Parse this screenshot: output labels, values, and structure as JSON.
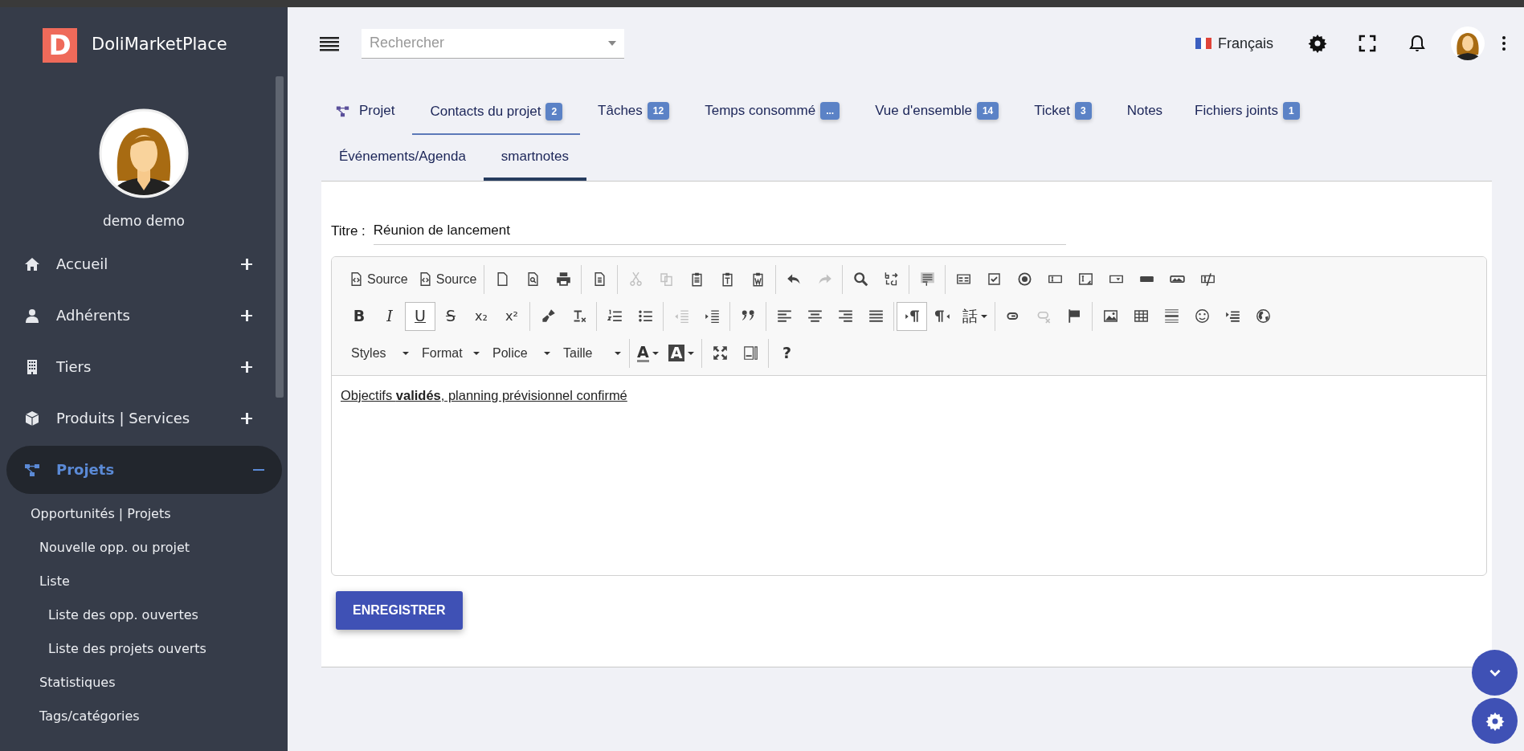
{
  "sidebar": {
    "logo_letter": "D",
    "brand": "DoliMarketPlace",
    "user_name": "demo demo",
    "items": [
      {
        "label": "Accueil",
        "selected": false,
        "expanded": false
      },
      {
        "label": "Adhérents",
        "selected": false,
        "expanded": false
      },
      {
        "label": "Tiers",
        "selected": false,
        "expanded": false
      },
      {
        "label": "Produits | Services",
        "selected": false,
        "expanded": false
      },
      {
        "label": "Projets",
        "selected": true,
        "expanded": true,
        "children": [
          {
            "label": "Opportunités | Projets",
            "children": [
              {
                "label": "Nouvelle opp. ou projet"
              },
              {
                "label": "Liste",
                "children": [
                  {
                    "label": "Liste des opp. ouvertes"
                  },
                  {
                    "label": "Liste des projets ouverts"
                  }
                ]
              },
              {
                "label": "Statistiques"
              },
              {
                "label": "Tags/catégories"
              }
            ]
          }
        ]
      }
    ]
  },
  "topbar": {
    "search": {
      "placeholder": "Rechercher"
    },
    "language": "Français"
  },
  "tabs": [
    {
      "label": "Projet",
      "selected": false,
      "hovered": false
    },
    {
      "label": "Contacts du projet",
      "badge": "2",
      "selected": false,
      "hovered": true
    },
    {
      "label": "Tâches",
      "badge": "12",
      "selected": false,
      "hovered": false
    },
    {
      "label": "Temps consommé",
      "badge": "...",
      "selected": false,
      "hovered": false
    },
    {
      "label": "Vue d'ensemble",
      "badge": "14",
      "selected": false,
      "hovered": false
    },
    {
      "label": "Ticket",
      "badge": "3",
      "selected": false,
      "hovered": false
    },
    {
      "label": "Notes",
      "selected": false,
      "hovered": false
    },
    {
      "label": "Fichiers joints",
      "badge": "1",
      "selected": false,
      "hovered": false
    },
    {
      "label": "Événements/Agenda",
      "selected": false,
      "hovered": false
    },
    {
      "label": "smartnotes",
      "selected": true,
      "hovered": false
    }
  ],
  "form": {
    "title_label": "Titre :",
    "title_value": "Réunion de lancement",
    "editor": {
      "toolbar": [
        [
          [
            {
              "kind": "text",
              "label": "Source",
              "disabled": false,
              "pressed": false
            },
            {
              "kind": "text",
              "label": "Source",
              "disabled": false,
              "pressed": false
            }
          ],
          [
            {
              "kind": "icon",
              "disabled": false,
              "pressed": false
            },
            {
              "kind": "icon",
              "disabled": false,
              "pressed": false
            },
            {
              "kind": "icon",
              "disabled": false,
              "pressed": false
            }
          ],
          [
            {
              "kind": "icon",
              "disabled": false,
              "pressed": false
            }
          ],
          [
            {
              "kind": "icon",
              "disabled": true,
              "pressed": false
            },
            {
              "kind": "icon",
              "disabled": true,
              "pressed": false
            },
            {
              "kind": "icon",
              "disabled": false,
              "pressed": false
            },
            {
              "kind": "icon",
              "disabled": false,
              "pressed": false
            },
            {
              "kind": "icon",
              "disabled": false,
              "pressed": false
            }
          ],
          [
            {
              "kind": "icon",
              "disabled": false,
              "pressed": false
            },
            {
              "kind": "icon",
              "disabled": true,
              "pressed": false
            }
          ],
          [
            {
              "kind": "icon",
              "disabled": false,
              "pressed": false
            },
            {
              "kind": "icon",
              "disabled": false,
              "pressed": false
            }
          ],
          [
            {
              "kind": "icon",
              "disabled": false,
              "pressed": false
            }
          ],
          [
            {
              "kind": "icon",
              "disabled": false,
              "pressed": false
            },
            {
              "kind": "icon",
              "disabled": false,
              "pressed": false
            },
            {
              "kind": "icon",
              "disabled": false,
              "pressed": false
            },
            {
              "kind": "icon",
              "disabled": false,
              "pressed": false
            },
            {
              "kind": "icon",
              "disabled": false,
              "pressed": false
            },
            {
              "kind": "icon",
              "disabled": false,
              "pressed": false
            },
            {
              "kind": "icon",
              "disabled": false,
              "pressed": false
            },
            {
              "kind": "icon",
              "disabled": false,
              "pressed": false
            },
            {
              "kind": "icon",
              "disabled": false,
              "pressed": false
            }
          ]
        ],
        [
          [
            {
              "kind": "glyph",
              "text": "B",
              "disabled": false,
              "pressed": false
            },
            {
              "kind": "glyph",
              "text": "I",
              "disabled": false,
              "pressed": false
            },
            {
              "kind": "glyph",
              "text": "U",
              "disabled": false,
              "pressed": true
            },
            {
              "kind": "glyph",
              "text": "S",
              "disabled": false,
              "pressed": false
            },
            {
              "kind": "glyph",
              "text": "x₂",
              "disabled": false,
              "pressed": false
            },
            {
              "kind": "glyph",
              "text": "x²",
              "disabled": false,
              "pressed": false
            }
          ],
          [
            {
              "kind": "icon",
              "disabled": false,
              "pressed": false
            },
            {
              "kind": "icon",
              "disabled": false,
              "pressed": false
            }
          ],
          [
            {
              "kind": "icon",
              "disabled": false,
              "pressed": false
            },
            {
              "kind": "icon",
              "disabled": false,
              "pressed": false
            }
          ],
          [
            {
              "kind": "icon",
              "disabled": true,
              "pressed": false
            },
            {
              "kind": "icon",
              "disabled": false,
              "pressed": false
            }
          ],
          [
            {
              "kind": "icon",
              "disabled": false,
              "pressed": false
            }
          ],
          [
            {
              "kind": "icon",
              "disabled": false,
              "pressed": false
            },
            {
              "kind": "icon",
              "disabled": false,
              "pressed": false
            },
            {
              "kind": "icon",
              "disabled": false,
              "pressed": false
            },
            {
              "kind": "icon",
              "disabled": false,
              "pressed": false
            }
          ],
          [
            {
              "kind": "icon",
              "disabled": false,
              "pressed": true
            },
            {
              "kind": "icon",
              "disabled": false,
              "pressed": false
            },
            {
              "kind": "glyph",
              "text": "話",
              "menu": true,
              "disabled": false,
              "pressed": false
            }
          ],
          [
            {
              "kind": "icon",
              "disabled": false,
              "pressed": false
            },
            {
              "kind": "icon",
              "disabled": true,
              "pressed": false
            },
            {
              "kind": "icon",
              "disabled": false,
              "pressed": false
            }
          ],
          [
            {
              "kind": "icon",
              "disabled": false,
              "pressed": false
            },
            {
              "kind": "icon",
              "disabled": false,
              "pressed": false
            },
            {
              "kind": "icon",
              "disabled": false,
              "pressed": false
            },
            {
              "kind": "icon",
              "disabled": false,
              "pressed": false
            },
            {
              "kind": "icon",
              "disabled": false,
              "pressed": false
            },
            {
              "kind": "icon",
              "disabled": false,
              "pressed": false
            }
          ]
        ],
        [
          [
            {
              "kind": "combo",
              "label": "Styles",
              "disabled": false,
              "pressed": false
            },
            {
              "kind": "combo",
              "label": "Format",
              "disabled": false,
              "pressed": false
            },
            {
              "kind": "combo",
              "label": "Police",
              "disabled": false,
              "pressed": false
            },
            {
              "kind": "combo",
              "label": "Taille",
              "disabled": false,
              "pressed": false
            }
          ],
          [
            {
              "kind": "glyph",
              "text": "A",
              "menu": true,
              "disabled": false,
              "pressed": false
            },
            {
              "kind": "glyph",
              "text": "A",
              "menu": true,
              "disabled": false,
              "pressed": false
            }
          ],
          [
            {
              "kind": "icon",
              "disabled": false,
              "pressed": false
            },
            {
              "kind": "icon",
              "disabled": false,
              "pressed": false
            }
          ],
          [
            {
              "kind": "glyph",
              "text": "?",
              "disabled": false,
              "pressed": false
            }
          ]
        ]
      ],
      "content": "Objectifs **validés**, planning prévisionnel confirmé"
    },
    "save_button": "ENREGISTRER"
  }
}
